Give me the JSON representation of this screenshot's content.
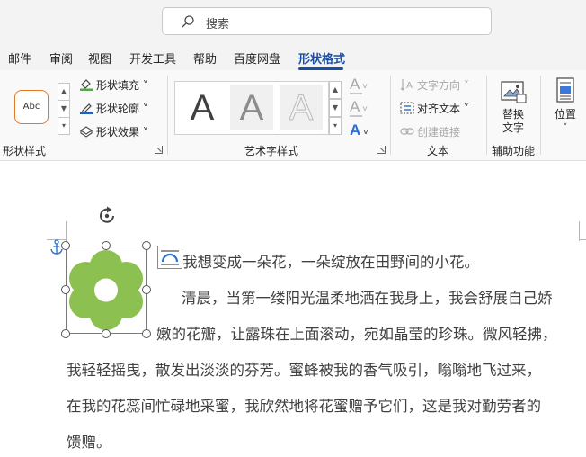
{
  "search": {
    "placeholder": "搜索",
    "icon": "search-icon"
  },
  "tabs": [
    {
      "label": "邮件",
      "active": false
    },
    {
      "label": "审阅",
      "active": false
    },
    {
      "label": "视图",
      "active": false
    },
    {
      "label": "开发工具",
      "active": false
    },
    {
      "label": "帮助",
      "active": false
    },
    {
      "label": "百度网盘",
      "active": false
    },
    {
      "label": "形状格式",
      "active": true
    }
  ],
  "accent_color": "#1a4ea2",
  "ribbon": {
    "shape_styles": {
      "preview_text": "Abc",
      "fill_label": "形状填充",
      "outline_label": "形状轮廓",
      "effects_label": "形状效果",
      "group_label": "形状样式"
    },
    "wordart": {
      "sample_glyph": "A",
      "group_label": "艺术字样式"
    },
    "text": {
      "direction_label": "文字方向",
      "align_label": "对齐文本",
      "link_label": "创建链接",
      "group_label": "文本"
    },
    "accessibility": {
      "alt_text_line1": "替换",
      "alt_text_line2": "文字",
      "group_label": "辅助功能"
    },
    "arrange": {
      "position_label": "位置"
    }
  },
  "document": {
    "lines": [
      "我想变成一朵花，一朵绽放在田野间的小花。",
      "清晨，当第一缕阳光温柔地洒在我身上，我会舒展自己娇",
      "嫩的花瓣，让露珠在上面滚动，宛如晶莹的珍珠。微风轻拂，",
      "我轻轻摇曳，散发出淡淡的芬芳。蜜蜂被我的香气吸引，嗡嗡地飞过来，",
      "在我的花蕊间忙碌地采蜜，我欣然地将花蜜赠予它们，这是我对勤劳者的",
      "馈赠。"
    ],
    "flower_color": "#8cc152"
  }
}
